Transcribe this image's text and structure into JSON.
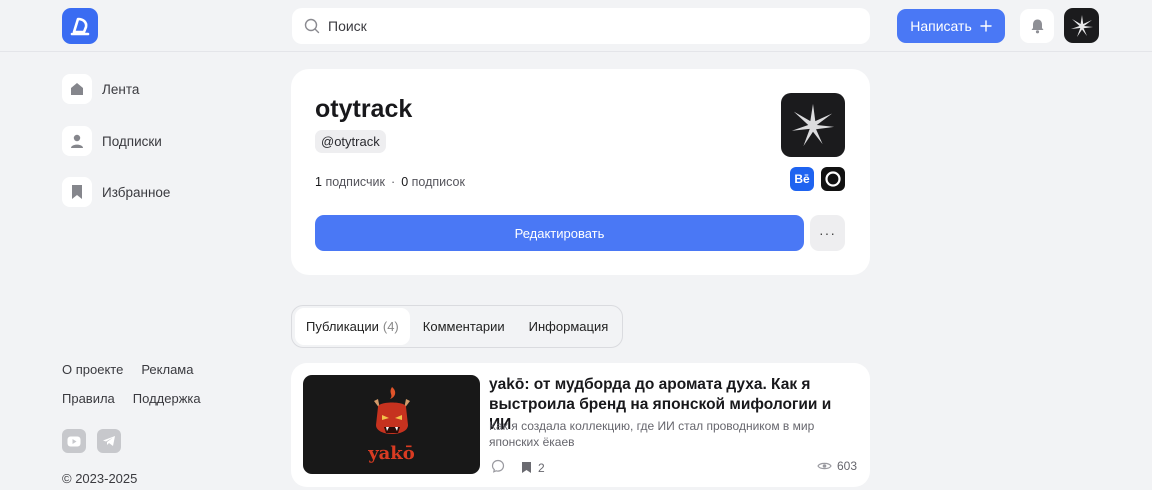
{
  "header": {
    "search_placeholder": "Поиск",
    "write_label": "Написать"
  },
  "sidebar": {
    "items": [
      {
        "label": "Лента"
      },
      {
        "label": "Подписки"
      },
      {
        "label": "Избранное"
      }
    ],
    "footer": {
      "about": "О проекте",
      "ads": "Реклама",
      "rules": "Правила",
      "support": "Поддержка",
      "copyright": "© 2023-2025"
    }
  },
  "profile": {
    "name": "otytrack",
    "handle": "@otytrack",
    "followers_count": "1",
    "followers_label": "подписчик",
    "following_count": "0",
    "following_label": "подписок",
    "separator": "·",
    "behance_label": "Bē",
    "edit_label": "Редактировать",
    "more_label": "···"
  },
  "tabs": {
    "publications": "Публикации",
    "publications_count": "(4)",
    "comments": "Комментарии",
    "info": "Информация"
  },
  "post": {
    "thumb_text": "yakō",
    "title": "yakō: от мудборда до аромата духа. Как я выстроила бренд на японской мифологии и ИИ",
    "description": "Как я создала коллекцию, где ИИ стал проводником в мир японских ёкаев",
    "bookmarks": "2",
    "views": "603"
  },
  "colors": {
    "accent": "#4a78f5",
    "background": "#f2f3f5",
    "card": "#ffffff",
    "thumb_red": "#d93b22"
  }
}
